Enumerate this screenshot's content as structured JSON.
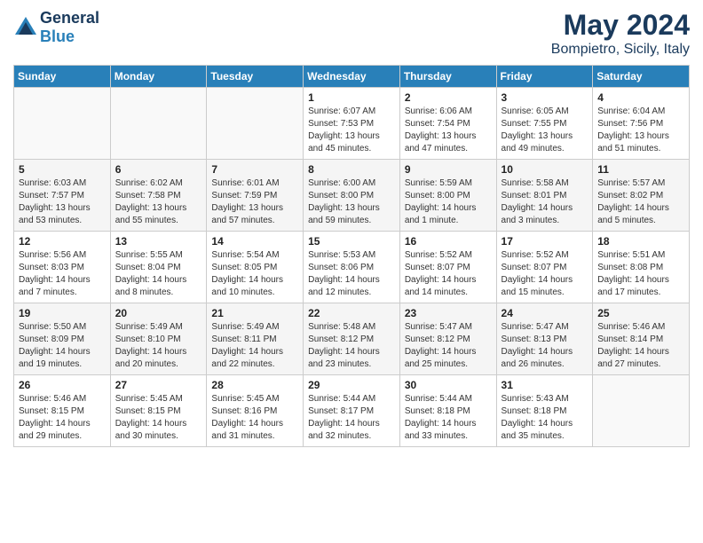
{
  "header": {
    "logo_line1": "General",
    "logo_line2": "Blue",
    "month_title": "May 2024",
    "location": "Bompietro, Sicily, Italy"
  },
  "weekdays": [
    "Sunday",
    "Monday",
    "Tuesday",
    "Wednesday",
    "Thursday",
    "Friday",
    "Saturday"
  ],
  "weeks": [
    [
      {
        "day": "",
        "sunrise": "",
        "sunset": "",
        "daylight": ""
      },
      {
        "day": "",
        "sunrise": "",
        "sunset": "",
        "daylight": ""
      },
      {
        "day": "",
        "sunrise": "",
        "sunset": "",
        "daylight": ""
      },
      {
        "day": "1",
        "sunrise": "Sunrise: 6:07 AM",
        "sunset": "Sunset: 7:53 PM",
        "daylight": "Daylight: 13 hours and 45 minutes."
      },
      {
        "day": "2",
        "sunrise": "Sunrise: 6:06 AM",
        "sunset": "Sunset: 7:54 PM",
        "daylight": "Daylight: 13 hours and 47 minutes."
      },
      {
        "day": "3",
        "sunrise": "Sunrise: 6:05 AM",
        "sunset": "Sunset: 7:55 PM",
        "daylight": "Daylight: 13 hours and 49 minutes."
      },
      {
        "day": "4",
        "sunrise": "Sunrise: 6:04 AM",
        "sunset": "Sunset: 7:56 PM",
        "daylight": "Daylight: 13 hours and 51 minutes."
      }
    ],
    [
      {
        "day": "5",
        "sunrise": "Sunrise: 6:03 AM",
        "sunset": "Sunset: 7:57 PM",
        "daylight": "Daylight: 13 hours and 53 minutes."
      },
      {
        "day": "6",
        "sunrise": "Sunrise: 6:02 AM",
        "sunset": "Sunset: 7:58 PM",
        "daylight": "Daylight: 13 hours and 55 minutes."
      },
      {
        "day": "7",
        "sunrise": "Sunrise: 6:01 AM",
        "sunset": "Sunset: 7:59 PM",
        "daylight": "Daylight: 13 hours and 57 minutes."
      },
      {
        "day": "8",
        "sunrise": "Sunrise: 6:00 AM",
        "sunset": "Sunset: 8:00 PM",
        "daylight": "Daylight: 13 hours and 59 minutes."
      },
      {
        "day": "9",
        "sunrise": "Sunrise: 5:59 AM",
        "sunset": "Sunset: 8:00 PM",
        "daylight": "Daylight: 14 hours and 1 minute."
      },
      {
        "day": "10",
        "sunrise": "Sunrise: 5:58 AM",
        "sunset": "Sunset: 8:01 PM",
        "daylight": "Daylight: 14 hours and 3 minutes."
      },
      {
        "day": "11",
        "sunrise": "Sunrise: 5:57 AM",
        "sunset": "Sunset: 8:02 PM",
        "daylight": "Daylight: 14 hours and 5 minutes."
      }
    ],
    [
      {
        "day": "12",
        "sunrise": "Sunrise: 5:56 AM",
        "sunset": "Sunset: 8:03 PM",
        "daylight": "Daylight: 14 hours and 7 minutes."
      },
      {
        "day": "13",
        "sunrise": "Sunrise: 5:55 AM",
        "sunset": "Sunset: 8:04 PM",
        "daylight": "Daylight: 14 hours and 8 minutes."
      },
      {
        "day": "14",
        "sunrise": "Sunrise: 5:54 AM",
        "sunset": "Sunset: 8:05 PM",
        "daylight": "Daylight: 14 hours and 10 minutes."
      },
      {
        "day": "15",
        "sunrise": "Sunrise: 5:53 AM",
        "sunset": "Sunset: 8:06 PM",
        "daylight": "Daylight: 14 hours and 12 minutes."
      },
      {
        "day": "16",
        "sunrise": "Sunrise: 5:52 AM",
        "sunset": "Sunset: 8:07 PM",
        "daylight": "Daylight: 14 hours and 14 minutes."
      },
      {
        "day": "17",
        "sunrise": "Sunrise: 5:52 AM",
        "sunset": "Sunset: 8:07 PM",
        "daylight": "Daylight: 14 hours and 15 minutes."
      },
      {
        "day": "18",
        "sunrise": "Sunrise: 5:51 AM",
        "sunset": "Sunset: 8:08 PM",
        "daylight": "Daylight: 14 hours and 17 minutes."
      }
    ],
    [
      {
        "day": "19",
        "sunrise": "Sunrise: 5:50 AM",
        "sunset": "Sunset: 8:09 PM",
        "daylight": "Daylight: 14 hours and 19 minutes."
      },
      {
        "day": "20",
        "sunrise": "Sunrise: 5:49 AM",
        "sunset": "Sunset: 8:10 PM",
        "daylight": "Daylight: 14 hours and 20 minutes."
      },
      {
        "day": "21",
        "sunrise": "Sunrise: 5:49 AM",
        "sunset": "Sunset: 8:11 PM",
        "daylight": "Daylight: 14 hours and 22 minutes."
      },
      {
        "day": "22",
        "sunrise": "Sunrise: 5:48 AM",
        "sunset": "Sunset: 8:12 PM",
        "daylight": "Daylight: 14 hours and 23 minutes."
      },
      {
        "day": "23",
        "sunrise": "Sunrise: 5:47 AM",
        "sunset": "Sunset: 8:12 PM",
        "daylight": "Daylight: 14 hours and 25 minutes."
      },
      {
        "day": "24",
        "sunrise": "Sunrise: 5:47 AM",
        "sunset": "Sunset: 8:13 PM",
        "daylight": "Daylight: 14 hours and 26 minutes."
      },
      {
        "day": "25",
        "sunrise": "Sunrise: 5:46 AM",
        "sunset": "Sunset: 8:14 PM",
        "daylight": "Daylight: 14 hours and 27 minutes."
      }
    ],
    [
      {
        "day": "26",
        "sunrise": "Sunrise: 5:46 AM",
        "sunset": "Sunset: 8:15 PM",
        "daylight": "Daylight: 14 hours and 29 minutes."
      },
      {
        "day": "27",
        "sunrise": "Sunrise: 5:45 AM",
        "sunset": "Sunset: 8:15 PM",
        "daylight": "Daylight: 14 hours and 30 minutes."
      },
      {
        "day": "28",
        "sunrise": "Sunrise: 5:45 AM",
        "sunset": "Sunset: 8:16 PM",
        "daylight": "Daylight: 14 hours and 31 minutes."
      },
      {
        "day": "29",
        "sunrise": "Sunrise: 5:44 AM",
        "sunset": "Sunset: 8:17 PM",
        "daylight": "Daylight: 14 hours and 32 minutes."
      },
      {
        "day": "30",
        "sunrise": "Sunrise: 5:44 AM",
        "sunset": "Sunset: 8:18 PM",
        "daylight": "Daylight: 14 hours and 33 minutes."
      },
      {
        "day": "31",
        "sunrise": "Sunrise: 5:43 AM",
        "sunset": "Sunset: 8:18 PM",
        "daylight": "Daylight: 14 hours and 35 minutes."
      },
      {
        "day": "",
        "sunrise": "",
        "sunset": "",
        "daylight": ""
      }
    ]
  ]
}
